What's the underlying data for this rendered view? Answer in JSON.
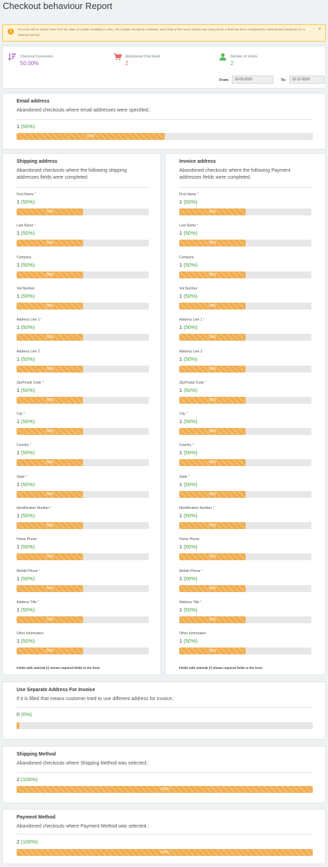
{
  "page": {
    "title": "Checkout behaviour Report"
  },
  "alert": {
    "icon": "warning-icon",
    "text": "Records will be shown here from the date of module installation (Also, the module should be enabled). Each field of the report shows how many times a field has been completed for abandoned checkouts for a selected period.",
    "close": "×"
  },
  "kpis": [
    {
      "label": "Checkout Conversion",
      "value": "50.00%",
      "icon": "sort-amount-icon",
      "color": "#a552c1"
    },
    {
      "label": "Abandoned Checkouts",
      "value": "2",
      "icon": "shopping-cart-icon",
      "color": "#e86a6a"
    },
    {
      "label": "Number of orders",
      "value": "2",
      "icon": "user-icon",
      "color": "#5aba5a"
    }
  ],
  "date_filter": {
    "from_label": "From:",
    "from_value": "23-09-2020",
    "to_label": "To:",
    "to_value": "23-12-2020"
  },
  "email_section": {
    "title": "Email address",
    "desc": "Abandoned checkouts where email addresses were specified.:",
    "count": "1",
    "pct": "(50%)",
    "bar_label": "50%",
    "fraction": 0.5
  },
  "shipping_section": {
    "title": "Shipping address",
    "desc_line1": "Abandoned checkouts where the following shipping",
    "desc_line2": "addresses fields were completed.",
    "footnote": "Fields with asterisk (*) shows required fields in the front.",
    "fields": [
      {
        "name": "First Name",
        "required": "*",
        "count": "1",
        "pct": "(50%)",
        "bar_label": "50%",
        "fraction": 0.5
      },
      {
        "name": "Last Name",
        "required": "*",
        "count": "1",
        "pct": "(50%)",
        "bar_label": "50%",
        "fraction": 0.5
      },
      {
        "name": "Company",
        "required": "",
        "count": "1",
        "pct": "(50%)",
        "bar_label": "50%",
        "fraction": 0.5
      },
      {
        "name": "Vat Number",
        "required": "",
        "count": "1",
        "pct": "(50%)",
        "bar_label": "50%",
        "fraction": 0.5
      },
      {
        "name": "Address Line 1",
        "required": "*",
        "count": "1",
        "pct": "(50%)",
        "bar_label": "50%",
        "fraction": 0.5
      },
      {
        "name": "Address Line 2",
        "required": "",
        "count": "1",
        "pct": "(50%)",
        "bar_label": "50%",
        "fraction": 0.5
      },
      {
        "name": "Zip/Postal Code",
        "required": "*",
        "count": "1",
        "pct": "(50%)",
        "bar_label": "50%",
        "fraction": 0.5
      },
      {
        "name": "City",
        "required": "*",
        "count": "1",
        "pct": "(50%)",
        "bar_label": "50%",
        "fraction": 0.5
      },
      {
        "name": "Country",
        "required": "*",
        "count": "1",
        "pct": "(50%)",
        "bar_label": "50%",
        "fraction": 0.5
      },
      {
        "name": "State",
        "required": "*",
        "count": "1",
        "pct": "(50%)",
        "bar_label": "50%",
        "fraction": 0.5
      },
      {
        "name": "Identification Number",
        "required": "*",
        "count": "1",
        "pct": "(50%)",
        "bar_label": "50%",
        "fraction": 0.5
      },
      {
        "name": "Home Phone",
        "required": "",
        "count": "1",
        "pct": "(50%)",
        "bar_label": "50%",
        "fraction": 0.5
      },
      {
        "name": "Mobile Phone",
        "required": "*",
        "count": "1",
        "pct": "(50%)",
        "bar_label": "50%",
        "fraction": 0.5
      },
      {
        "name": "Address Title",
        "required": "*",
        "count": "1",
        "pct": "(50%)",
        "bar_label": "50%",
        "fraction": 0.5
      },
      {
        "name": "Other Information",
        "required": "",
        "count": "1",
        "pct": "(50%)",
        "bar_label": "50%",
        "fraction": 0.5
      }
    ]
  },
  "invoice_section": {
    "title": "Invoice address",
    "desc_line1": "Abandoned checkouts where the following Payment",
    "desc_line2": "addresses fields were completed.",
    "footnote": "Fields with asterisk (*) shows required fields in the front.",
    "fields": [
      {
        "name": "First Name",
        "required": "*",
        "count": "1",
        "pct": "(50%)",
        "bar_label": "50%",
        "fraction": 0.5
      },
      {
        "name": "Last Name",
        "required": "*",
        "count": "1",
        "pct": "(50%)",
        "bar_label": "50%",
        "fraction": 0.5
      },
      {
        "name": "Company",
        "required": "",
        "count": "1",
        "pct": "(50%)",
        "bar_label": "50%",
        "fraction": 0.5
      },
      {
        "name": "Vat Number",
        "required": "",
        "count": "1",
        "pct": "(50%)",
        "bar_label": "50%",
        "fraction": 0.5
      },
      {
        "name": "Address Line 1",
        "required": "*",
        "count": "1",
        "pct": "(50%)",
        "bar_label": "50%",
        "fraction": 0.5
      },
      {
        "name": "Address Line 2",
        "required": "",
        "count": "1",
        "pct": "(50%)",
        "bar_label": "50%",
        "fraction": 0.5
      },
      {
        "name": "Zip/Postal Code",
        "required": "*",
        "count": "1",
        "pct": "(50%)",
        "bar_label": "50%",
        "fraction": 0.5
      },
      {
        "name": "City",
        "required": "*",
        "count": "1",
        "pct": "(50%)",
        "bar_label": "50%",
        "fraction": 0.5
      },
      {
        "name": "Country",
        "required": "*",
        "count": "1",
        "pct": "(50%)",
        "bar_label": "50%",
        "fraction": 0.5
      },
      {
        "name": "State",
        "required": "*",
        "count": "1",
        "pct": "(50%)",
        "bar_label": "50%",
        "fraction": 0.5
      },
      {
        "name": "Identification Number",
        "required": "*",
        "count": "1",
        "pct": "(50%)",
        "bar_label": "50%",
        "fraction": 0.5
      },
      {
        "name": "Home Phone",
        "required": "",
        "count": "1",
        "pct": "(50%)",
        "bar_label": "50%",
        "fraction": 0.5
      },
      {
        "name": "Mobile Phone",
        "required": "*",
        "count": "1",
        "pct": "(50%)",
        "bar_label": "50%",
        "fraction": 0.5
      },
      {
        "name": "Address Title",
        "required": "*",
        "count": "1",
        "pct": "(50%)",
        "bar_label": "50%",
        "fraction": 0.5
      },
      {
        "name": "Other Information",
        "required": "",
        "count": "1",
        "pct": "(50%)",
        "bar_label": "50%",
        "fraction": 0.5
      }
    ]
  },
  "separate_section": {
    "title": "Use Separate Address For Invoice",
    "desc": "If it is filled that means customer tried to use different address for invoice.:",
    "count": "0",
    "pct": "(0%)",
    "bar_label": "",
    "fraction": 0
  },
  "shipping_method_section": {
    "title": "Shipping Method",
    "desc": "Abandoned checkouts where Shipping Method was selected.:",
    "count": "2",
    "pct": "(100%)",
    "bar_label": "100%",
    "fraction": 1
  },
  "payment_method_section": {
    "title": "Payment Method",
    "desc": "Abandoned checkouts where Payment Method was selected.:",
    "count": "2",
    "pct": "(100%)",
    "bar_label": "100%",
    "fraction": 1
  }
}
